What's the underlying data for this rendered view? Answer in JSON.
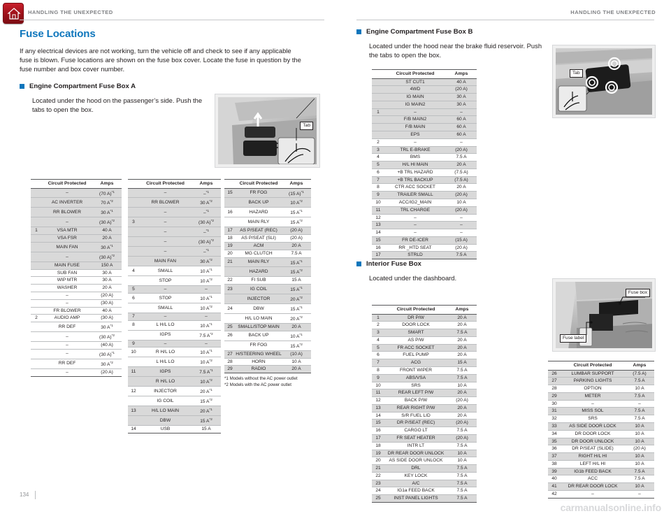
{
  "header": {
    "left_title": "HANDLING THE UNEXPECTED",
    "right_title": "HANDLING THE UNEXPECTED",
    "home_icon": "home-icon"
  },
  "footer": {
    "page_number": "134",
    "watermark": "carmanualsonline.info"
  },
  "section": {
    "title": "Fuse Locations",
    "intro": "If any electrical devices are not working, turn the vehicle off and check to see if any applicable fuse is blown. Fuse locations are shown on the fuse box cover. Locate the fuse in question by the fuse number and box cover number."
  },
  "subsections": {
    "box_a": {
      "heading": "Engine Compartment Fuse Box A",
      "body": "Located under the hood on the passenger’s side. Push the tabs to open the box.",
      "photo_label": "Tab"
    },
    "box_b": {
      "heading": "Engine Compartment Fuse Box B",
      "body": "Located under the hood near the brake fluid reservoir. Push the tabs to open the box.",
      "photo_label": "Tab"
    },
    "interior": {
      "heading": "Interior Fuse Box",
      "body": "Located under the dashboard.",
      "photo_label_1": "Fuse box",
      "photo_label_2": "Fuse label"
    }
  },
  "table_headers": {
    "circuit": "Circuit Protected",
    "amps": "Amps"
  },
  "footnotes": {
    "f1": "*1 Models without the AC power outlet",
    "f2": "*2 Models with the AC power outlet"
  },
  "tables": {
    "box_a_col1": [
      {
        "num": "",
        "circuit": "–",
        "amps": "(70 A)*1",
        "shade": true
      },
      {
        "num": "",
        "circuit": "AC INVERTER",
        "amps": "70 A*2",
        "shade": true
      },
      {
        "num": "",
        "circuit": "RR BLOWER",
        "amps": "30 A*1",
        "shade": true
      },
      {
        "num": "",
        "circuit": "–",
        "amps": "(30 A)*2",
        "shade": true
      },
      {
        "num": "1",
        "circuit": "VSA MTR",
        "amps": "40 A",
        "shade": true
      },
      {
        "num": "",
        "circuit": "VSA FSR",
        "amps": "20 A",
        "shade": true
      },
      {
        "num": "",
        "circuit": "MAIN FAN",
        "amps": "30 A*1",
        "shade": true
      },
      {
        "num": "",
        "circuit": "–",
        "amps": "(30 A)*2",
        "shade": true
      },
      {
        "num": "",
        "circuit": "MAIN FUSE",
        "amps": "150 A",
        "shade": true
      },
      {
        "num": "",
        "circuit": "SUB FAN",
        "amps": "30 A",
        "shade": false
      },
      {
        "num": "",
        "circuit": "WIP MTR",
        "amps": "30 A",
        "shade": false
      },
      {
        "num": "",
        "circuit": "WASHER",
        "amps": "20 A",
        "shade": false
      },
      {
        "num": "",
        "circuit": "–",
        "amps": "(20 A)",
        "shade": false
      },
      {
        "num": "",
        "circuit": "–",
        "amps": "(30 A)",
        "shade": false
      },
      {
        "num": "",
        "circuit": "FR BLOWER",
        "amps": "40 A",
        "shade": false
      },
      {
        "num": "2",
        "circuit": "AUDIO AMP",
        "amps": "(30 A)",
        "shade": false
      },
      {
        "num": "",
        "circuit": "RR DEF",
        "amps": "30 A*1",
        "shade": false
      },
      {
        "num": "",
        "circuit": "–",
        "amps": "(30 A)*2",
        "shade": false
      },
      {
        "num": "",
        "circuit": "–",
        "amps": "(40 A)",
        "shade": false
      },
      {
        "num": "",
        "circuit": "–",
        "amps": "(30 A)*1",
        "shade": false
      },
      {
        "num": "",
        "circuit": "RR DEF",
        "amps": "30 A*2",
        "shade": false
      },
      {
        "num": "",
        "circuit": "–",
        "amps": "(20 A)",
        "shade": false
      }
    ],
    "box_a_col2": [
      {
        "num": "",
        "circuit": "–",
        "amps": "–*1",
        "shade": true
      },
      {
        "num": "",
        "circuit": "RR BLOWER",
        "amps": "30 A*2",
        "shade": true
      },
      {
        "num": "",
        "circuit": "–",
        "amps": "–*1",
        "shade": true
      },
      {
        "num": "3",
        "circuit": "–",
        "amps": "(30 A)*2",
        "shade": true
      },
      {
        "num": "",
        "circuit": "–",
        "amps": "–*1",
        "shade": true
      },
      {
        "num": "",
        "circuit": "–",
        "amps": "(30 A)*2",
        "shade": true
      },
      {
        "num": "",
        "circuit": "–",
        "amps": "–*1",
        "shade": true
      },
      {
        "num": "",
        "circuit": "MAIN FAN",
        "amps": "30 A*2",
        "shade": true
      },
      {
        "num": "4",
        "circuit": "SMALL",
        "amps": "10 A*1",
        "shade": false
      },
      {
        "num": "",
        "circuit": "STOP",
        "amps": "10 A*2",
        "shade": false
      },
      {
        "num": "5",
        "circuit": "–",
        "amps": "–",
        "shade": true
      },
      {
        "num": "6",
        "circuit": "STOP",
        "amps": "10 A*1",
        "shade": false
      },
      {
        "num": "",
        "circuit": "SMALL",
        "amps": "10 A*2",
        "shade": false
      },
      {
        "num": "7",
        "circuit": "–",
        "amps": "–",
        "shade": true
      },
      {
        "num": "8",
        "circuit": "L H/L LO",
        "amps": "10 A*1",
        "shade": false
      },
      {
        "num": "",
        "circuit": "IGPS",
        "amps": "7.5 A*2",
        "shade": false
      },
      {
        "num": "9",
        "circuit": "–",
        "amps": "–",
        "shade": true
      },
      {
        "num": "10",
        "circuit": "R H/L LO",
        "amps": "10 A*1",
        "shade": false
      },
      {
        "num": "",
        "circuit": "L H/L LO",
        "amps": "10 A*2",
        "shade": false
      },
      {
        "num": "11",
        "circuit": "IGPS",
        "amps": "7.5 A*1",
        "shade": true
      },
      {
        "num": "",
        "circuit": "R H/L LO",
        "amps": "10 A*2",
        "shade": true
      },
      {
        "num": "12",
        "circuit": "INJECTOR",
        "amps": "20 A*1",
        "shade": false
      },
      {
        "num": "",
        "circuit": "IG COIL",
        "amps": "15 A*2",
        "shade": false
      },
      {
        "num": "13",
        "circuit": "H/L LO MAIN",
        "amps": "20 A*1",
        "shade": true
      },
      {
        "num": "",
        "circuit": "DBW",
        "amps": "15 A*2",
        "shade": true
      },
      {
        "num": "14",
        "circuit": "USB",
        "amps": "15 A",
        "shade": false
      }
    ],
    "box_a_col3": [
      {
        "num": "15",
        "circuit": "FR FOG",
        "amps": "(15 A)*1",
        "shade": true
      },
      {
        "num": "",
        "circuit": "BACK UP",
        "amps": "10 A*2",
        "shade": true
      },
      {
        "num": "16",
        "circuit": "HAZARD",
        "amps": "15 A*1",
        "shade": false
      },
      {
        "num": "",
        "circuit": "MAIN RLY",
        "amps": "15 A*2",
        "shade": false
      },
      {
        "num": "17",
        "circuit": "AS P/SEAT (REC)",
        "amps": "(20 A)",
        "shade": true
      },
      {
        "num": "18",
        "circuit": "AS P/SEAT (SLI)",
        "amps": "(20 A)",
        "shade": false
      },
      {
        "num": "19",
        "circuit": "ACM",
        "amps": "20 A",
        "shade": true
      },
      {
        "num": "20",
        "circuit": "MG CLUTCH",
        "amps": "7.5 A",
        "shade": false
      },
      {
        "num": "21",
        "circuit": "MAIN RLY",
        "amps": "15 A*1",
        "shade": true
      },
      {
        "num": "",
        "circuit": "HAZARD",
        "amps": "15 A*2",
        "shade": true
      },
      {
        "num": "22",
        "circuit": "FI SUB",
        "amps": "15 A",
        "shade": false
      },
      {
        "num": "23",
        "circuit": "IG COIL",
        "amps": "15 A*1",
        "shade": true
      },
      {
        "num": "",
        "circuit": "INJECTOR",
        "amps": "20 A*2",
        "shade": true
      },
      {
        "num": "24",
        "circuit": "DBW",
        "amps": "15 A*1",
        "shade": false
      },
      {
        "num": "",
        "circuit": "H/L LO MAIN",
        "amps": "20 A*2",
        "shade": false
      },
      {
        "num": "25",
        "circuit": "SMALL/STOP MAIN",
        "amps": "20 A",
        "shade": true
      },
      {
        "num": "26",
        "circuit": "BACK UP",
        "amps": "10 A*1",
        "shade": false
      },
      {
        "num": "",
        "circuit": "FR FOG",
        "amps": "15 A*2",
        "shade": false
      },
      {
        "num": "27",
        "circuit": "H/STEERING WHEEL",
        "amps": "(10 A)",
        "shade": true
      },
      {
        "num": "28",
        "circuit": "HORN",
        "amps": "10 A",
        "shade": false
      },
      {
        "num": "29",
        "circuit": "RADIO",
        "amps": "20 A",
        "shade": true
      }
    ],
    "box_b": [
      {
        "num": "",
        "circuit": "ST CUT1",
        "amps": "40 A",
        "shade": true
      },
      {
        "num": "",
        "circuit": "4WD",
        "amps": "(20 A)",
        "shade": true
      },
      {
        "num": "",
        "circuit": "IG MAIN",
        "amps": "30 A",
        "shade": true
      },
      {
        "num": "",
        "circuit": "IG MAIN2",
        "amps": "30 A",
        "shade": true
      },
      {
        "num": "1",
        "circuit": "–",
        "amps": "–",
        "shade": true
      },
      {
        "num": "",
        "circuit": "F/B MAIN2",
        "amps": "60 A",
        "shade": true
      },
      {
        "num": "",
        "circuit": "F/B MAIN",
        "amps": "60 A",
        "shade": true
      },
      {
        "num": "",
        "circuit": "EPS",
        "amps": "60 A",
        "shade": true
      },
      {
        "num": "2",
        "circuit": "–",
        "amps": "–",
        "shade": false
      },
      {
        "num": "3",
        "circuit": "TRL E-BRAKE",
        "amps": "(20 A)",
        "shade": true
      },
      {
        "num": "4",
        "circuit": "BMS",
        "amps": "7.5 A",
        "shade": false
      },
      {
        "num": "5",
        "circuit": "H/L HI MAIN",
        "amps": "20 A",
        "shade": true
      },
      {
        "num": "6",
        "circuit": "+B TRL HAZARD",
        "amps": "(7.5 A)",
        "shade": false
      },
      {
        "num": "7",
        "circuit": "+B TRL BACKUP",
        "amps": "(7.5 A)",
        "shade": true
      },
      {
        "num": "8",
        "circuit": "CTR ACC SOCKET",
        "amps": "20 A",
        "shade": false
      },
      {
        "num": "9",
        "circuit": "TRAILER SMALL",
        "amps": "(20 A)",
        "shade": true
      },
      {
        "num": "10",
        "circuit": "ACC/IG2_MAIN",
        "amps": "10 A",
        "shade": false
      },
      {
        "num": "11",
        "circuit": "TRL CHARGE",
        "amps": "(20 A)",
        "shade": true
      },
      {
        "num": "12",
        "circuit": "–",
        "amps": "–",
        "shade": false
      },
      {
        "num": "13",
        "circuit": "–",
        "amps": "–",
        "shade": true
      },
      {
        "num": "14",
        "circuit": "–",
        "amps": "–",
        "shade": false
      },
      {
        "num": "15",
        "circuit": "FR DE-ICER",
        "amps": "(15 A)",
        "shade": true
      },
      {
        "num": "16",
        "circuit": "RR _HTD SEAT",
        "amps": "(20 A)",
        "shade": false
      },
      {
        "num": "17",
        "circuit": "STRLD",
        "amps": "7.5 A",
        "shade": true
      }
    ],
    "interior_col1": [
      {
        "num": "1",
        "circuit": "DR P/W",
        "amps": "20 A",
        "shade": true
      },
      {
        "num": "2",
        "circuit": "DOOR LOCK",
        "amps": "20 A",
        "shade": false
      },
      {
        "num": "3",
        "circuit": "SMART",
        "amps": "7.5 A",
        "shade": true
      },
      {
        "num": "4",
        "circuit": "AS P/W",
        "amps": "20 A",
        "shade": false
      },
      {
        "num": "5",
        "circuit": "FR ACC SOCKET",
        "amps": "20 A",
        "shade": true
      },
      {
        "num": "6",
        "circuit": "FUEL PUMP",
        "amps": "20 A",
        "shade": false
      },
      {
        "num": "7",
        "circuit": "ACG",
        "amps": "15 A",
        "shade": true
      },
      {
        "num": "8",
        "circuit": "FRONT WIPER",
        "amps": "7.5 A",
        "shade": false
      },
      {
        "num": "9",
        "circuit": "ABS/VSA",
        "amps": "7.5 A",
        "shade": true
      },
      {
        "num": "10",
        "circuit": "SRS",
        "amps": "10 A",
        "shade": false
      },
      {
        "num": "11",
        "circuit": "REAR LEFT P/W",
        "amps": "20 A",
        "shade": true
      },
      {
        "num": "12",
        "circuit": "BACK P/W",
        "amps": "(20 A)",
        "shade": false
      },
      {
        "num": "13",
        "circuit": "REAR RIGHT P/W",
        "amps": "20 A",
        "shade": true
      },
      {
        "num": "14",
        "circuit": "S/R FUEL LID",
        "amps": "20 A",
        "shade": false
      },
      {
        "num": "15",
        "circuit": "DR P/SEAT (REC)",
        "amps": "(20 A)",
        "shade": true
      },
      {
        "num": "16",
        "circuit": "CARGO LT",
        "amps": "7.5 A",
        "shade": false
      },
      {
        "num": "17",
        "circuit": "FR SEAT HEATER",
        "amps": "(20 A)",
        "shade": true
      },
      {
        "num": "18",
        "circuit": "INTR LT",
        "amps": "7.5 A",
        "shade": false
      },
      {
        "num": "19",
        "circuit": "DR REAR DOOR UNLOCK",
        "amps": "10 A",
        "shade": true
      },
      {
        "num": "20",
        "circuit": "AS SIDE DOOR UNLOCK",
        "amps": "10 A",
        "shade": false
      },
      {
        "num": "21",
        "circuit": "DRL",
        "amps": "7.5 A",
        "shade": true
      },
      {
        "num": "22",
        "circuit": "KEY LOCK",
        "amps": "7.5 A",
        "shade": false
      },
      {
        "num": "23",
        "circuit": "A/C",
        "amps": "7.5 A",
        "shade": true
      },
      {
        "num": "24",
        "circuit": "IG1a FEED BACK",
        "amps": "7.5 A",
        "shade": false
      },
      {
        "num": "25",
        "circuit": "INST PANEL LIGHTS",
        "amps": "7.5 A",
        "shade": true
      }
    ],
    "interior_col2": [
      {
        "num": "26",
        "circuit": "LUMBAR SUPPORT",
        "amps": "(7.5 A)",
        "shade": true
      },
      {
        "num": "27",
        "circuit": "PARKING LIGHTS",
        "amps": "7.5 A",
        "shade": true
      },
      {
        "num": "28",
        "circuit": "OPTION",
        "amps": "10 A",
        "shade": false
      },
      {
        "num": "29",
        "circuit": "METER",
        "amps": "7.5 A",
        "shade": true
      },
      {
        "num": "30",
        "circuit": "–",
        "amps": "–",
        "shade": false
      },
      {
        "num": "31",
        "circuit": "MISS SOL",
        "amps": "7.5 A",
        "shade": true
      },
      {
        "num": "32",
        "circuit": "SRS",
        "amps": "7.5 A",
        "shade": false
      },
      {
        "num": "33",
        "circuit": "AS SIDE DOOR LOCK",
        "amps": "10 A",
        "shade": true
      },
      {
        "num": "34",
        "circuit": "DR DOOR LOCK",
        "amps": "10 A",
        "shade": false
      },
      {
        "num": "35",
        "circuit": "DR DOOR UNLOCK",
        "amps": "10 A",
        "shade": true
      },
      {
        "num": "36",
        "circuit": "DR P/SEAT (SLIDE)",
        "amps": "(20 A)",
        "shade": false
      },
      {
        "num": "37",
        "circuit": "RIGHT H/L HI",
        "amps": "10 A",
        "shade": true
      },
      {
        "num": "38",
        "circuit": "LEFT H/L HI",
        "amps": "10 A",
        "shade": false
      },
      {
        "num": "39",
        "circuit": "IG1b FEED BACK",
        "amps": "7.5 A",
        "shade": true
      },
      {
        "num": "40",
        "circuit": "ACC",
        "amps": "7.5 A",
        "shade": false
      },
      {
        "num": "41",
        "circuit": "DR REAR DOOR LOCK",
        "amps": "10 A",
        "shade": true
      },
      {
        "num": "42",
        "circuit": "–",
        "amps": "–",
        "shade": false
      }
    ]
  }
}
